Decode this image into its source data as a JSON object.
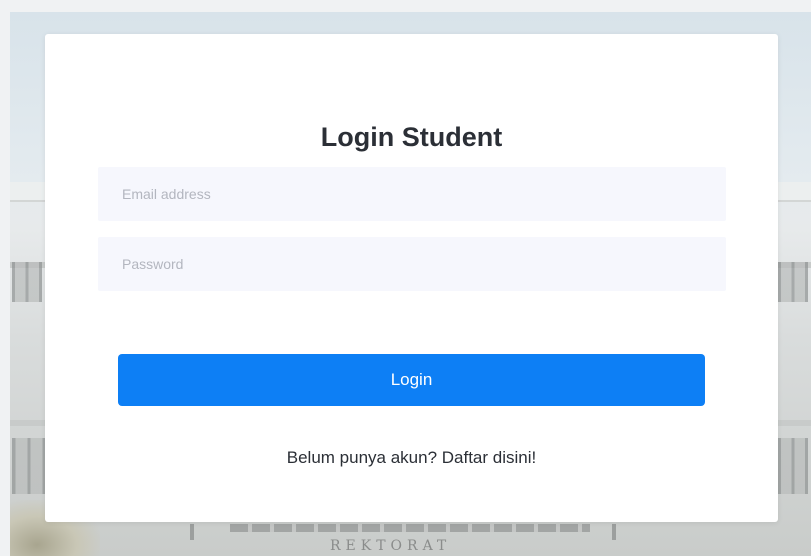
{
  "background": {
    "sign_text": "REKTORAT"
  },
  "login": {
    "title": "Login Student",
    "email_placeholder": "Email address",
    "password_placeholder": "Password",
    "submit_label": "Login",
    "register_link": "Belum punya akun? Daftar disini!"
  },
  "colors": {
    "accent": "#0d7ff5",
    "input_background": "#f6f7fd",
    "card_background": "#ffffff",
    "text": "#2b2f36"
  }
}
